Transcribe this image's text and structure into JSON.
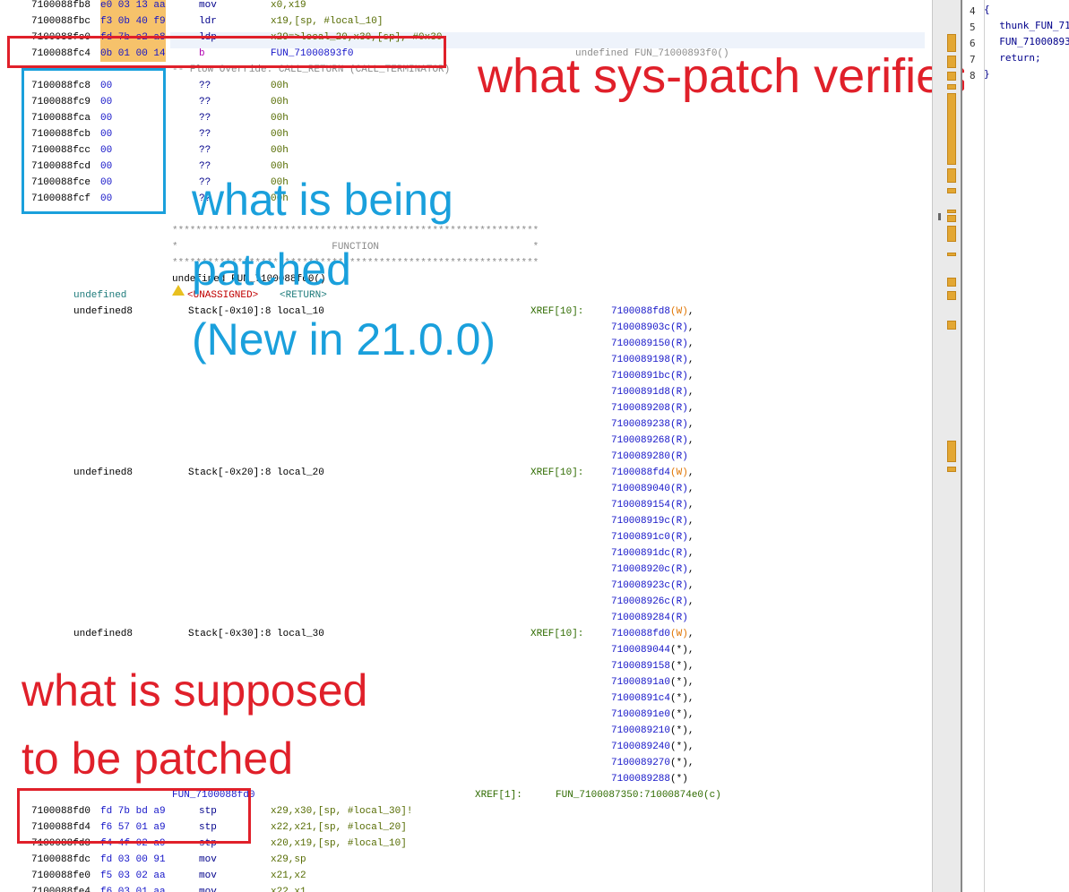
{
  "listing": {
    "top_rows": [
      {
        "addr": "7100088fb8",
        "bytes": "e0 03 13 aa",
        "mnem": "mov",
        "ops": "x0,x19",
        "hl": true
      },
      {
        "addr": "7100088fbc",
        "bytes": "f3 0b 40 f9",
        "mnem": "ldr",
        "ops": "x19,[sp, #local_10]",
        "hl": true
      },
      {
        "addr": "7100088fc0",
        "bytes": "fd 7b c2 a8",
        "mnem": "ldp",
        "ops": "x29=>local_20,x30,[sp], #0x30",
        "hl": true
      },
      {
        "addr": "7100088fc4",
        "bytes": "0b 01 00 14",
        "mnem": "b",
        "ops": "FUN_71000893f0",
        "hl": true
      }
    ],
    "called_fn_comment": "undefined FUN_71000893f0()",
    "flow_override": "-- Flow Override: CALL_RETURN (CALL_TERMINATOR)",
    "zero_rows": [
      {
        "addr": "7100088fc8",
        "bytes": "00",
        "mnem": "??",
        "ops": "00h"
      },
      {
        "addr": "7100088fc9",
        "bytes": "00",
        "mnem": "??",
        "ops": "00h"
      },
      {
        "addr": "7100088fca",
        "bytes": "00",
        "mnem": "??",
        "ops": "00h"
      },
      {
        "addr": "7100088fcb",
        "bytes": "00",
        "mnem": "??",
        "ops": "00h"
      },
      {
        "addr": "7100088fcc",
        "bytes": "00",
        "mnem": "??",
        "ops": "00h"
      },
      {
        "addr": "7100088fcd",
        "bytes": "00",
        "mnem": "??",
        "ops": "00h"
      },
      {
        "addr": "7100088fce",
        "bytes": "00",
        "mnem": "??",
        "ops": "00h"
      },
      {
        "addr": "7100088fcf",
        "bytes": "00",
        "mnem": "??",
        "ops": "00h"
      }
    ],
    "stars": "**************************************************************",
    "function_banner": "*                          FUNCTION                          *",
    "signature": "undefined FUN_7100088fd0()",
    "ret_type": "undefined",
    "unassigned": "<UNASSIGNED>",
    "ret": "<RETURN>",
    "locals": [
      {
        "type": "undefined8",
        "loc": "Stack[-0x10]:8 local_10",
        "xref": "XREF[10]:",
        "refs": [
          "7100088fd8(W),",
          "710008903c(R),",
          "7100089150(R),",
          "7100089198(R),",
          "71000891bc(R),",
          "71000891d8(R),",
          "7100089208(R),",
          "7100089238(R),",
          "7100089268(R),",
          "7100089280(R)"
        ]
      },
      {
        "type": "undefined8",
        "loc": "Stack[-0x20]:8 local_20",
        "xref": "XREF[10]:",
        "refs": [
          "7100088fd4(W),",
          "7100089040(R),",
          "7100089154(R),",
          "710008919c(R),",
          "71000891c0(R),",
          "71000891dc(R),",
          "710008920c(R),",
          "710008923c(R),",
          "710008926c(R),",
          "7100089284(R)"
        ]
      },
      {
        "type": "undefined8",
        "loc": "Stack[-0x30]:8 local_30",
        "xref": "XREF[10]:",
        "refs": [
          "7100088fd0(W),",
          "7100089044(*),",
          "7100089158(*),",
          "71000891a0(*),",
          "71000891c4(*),",
          "71000891e0(*),",
          "7100089210(*),",
          "7100089240(*),",
          "7100089270(*),",
          "7100089288(*)"
        ]
      }
    ],
    "fn_label": "FUN_7100088fd0",
    "fn_xref": "XREF[1]:",
    "fn_xref_val": "FUN_7100087350:71000874e0(c)",
    "bottom_rows": [
      {
        "addr": "7100088fd0",
        "bytes": "fd 7b bd a9",
        "mnem": "stp",
        "ops": "x29,x30,[sp, #local_30]!"
      },
      {
        "addr": "7100088fd4",
        "bytes": "f6 57 01 a9",
        "mnem": "stp",
        "ops": "x22,x21,[sp, #local_20]"
      },
      {
        "addr": "7100088fd8",
        "bytes": "f4 4f 02 a9",
        "mnem": "stp",
        "ops": "x20,x19,[sp, #local_10]"
      },
      {
        "addr": "7100088fdc",
        "bytes": "fd 03 00 91",
        "mnem": "mov",
        "ops": "x29,sp"
      },
      {
        "addr": "7100088fe0",
        "bytes": "f5 03 02 aa",
        "mnem": "mov",
        "ops": "x21,x2"
      },
      {
        "addr": "7100088fe4",
        "bytes": "f6 03 01 aa",
        "mnem": "mov",
        "ops": "x22,x1"
      }
    ]
  },
  "annotations": {
    "red_top": "what sys-patch verifies",
    "blue_lines": [
      "what is being",
      "patched",
      "(New in 21.0.0)"
    ],
    "red_bottom_lines": [
      "what is supposed",
      "to be patched"
    ],
    "red_color": "#e0202a",
    "blue_color": "#1aa0dc"
  },
  "decompiler": {
    "line_numbers": [
      "4",
      "5",
      "6",
      "7",
      "8"
    ],
    "lines": [
      "{",
      "  thunk_FUN_71",
      "  FUN_71000893",
      "  return;",
      "}"
    ]
  },
  "colors": {
    "address_bytes": "#1414c8",
    "mnemonic": "#00008b",
    "operands": "#556b00",
    "highlight": "#f6c26b"
  }
}
